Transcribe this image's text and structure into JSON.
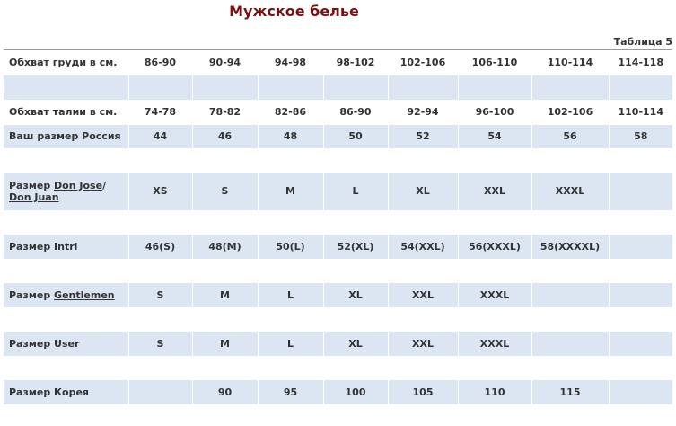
{
  "title": "Мужское белье",
  "table_label": "Таблица 5",
  "rows": {
    "chest": {
      "label": "Обхват груди в см.",
      "values": [
        "86-90",
        "90-94",
        "94-98",
        "98-102",
        "102-106",
        "106-110",
        "110-114",
        "114-118"
      ]
    },
    "waist": {
      "label": "Обхват талии в см.",
      "values": [
        "74-78",
        "78-82",
        "82-86",
        "86-90",
        "92-94",
        "96-100",
        "102-106",
        "110-114"
      ]
    },
    "russia": {
      "label": "Ваш размер Россия",
      "values": [
        "44",
        "46",
        "48",
        "50",
        "52",
        "54",
        "56",
        "58"
      ]
    },
    "donjose": {
      "label_prefix": "Размер ",
      "link1": "Don Jose",
      "sep": "/ ",
      "link2": "Don Juan",
      "values": [
        "XS",
        "S",
        "M",
        "L",
        "XL",
        "XXL",
        "XXXL",
        ""
      ]
    },
    "intri": {
      "label": "Размер Intri",
      "values": [
        "46(S)",
        "48(M)",
        "50(L)",
        "52(XL)",
        "54(XXL)",
        "56(XXXL)",
        "58(XXXXL)",
        ""
      ]
    },
    "gentlemen": {
      "label_prefix": "Размер ",
      "link": "Gentlemen",
      "values": [
        "S",
        "M",
        "L",
        "XL",
        "XXL",
        "XXXL",
        "",
        ""
      ]
    },
    "user": {
      "label": "Размер User",
      "values": [
        "S",
        "M",
        "L",
        "XL",
        "XXL",
        "XXXL",
        "",
        ""
      ]
    },
    "korea": {
      "label": "Размер Корея",
      "values": [
        "",
        "90",
        "95",
        "100",
        "105",
        "110",
        "115",
        ""
      ]
    }
  }
}
